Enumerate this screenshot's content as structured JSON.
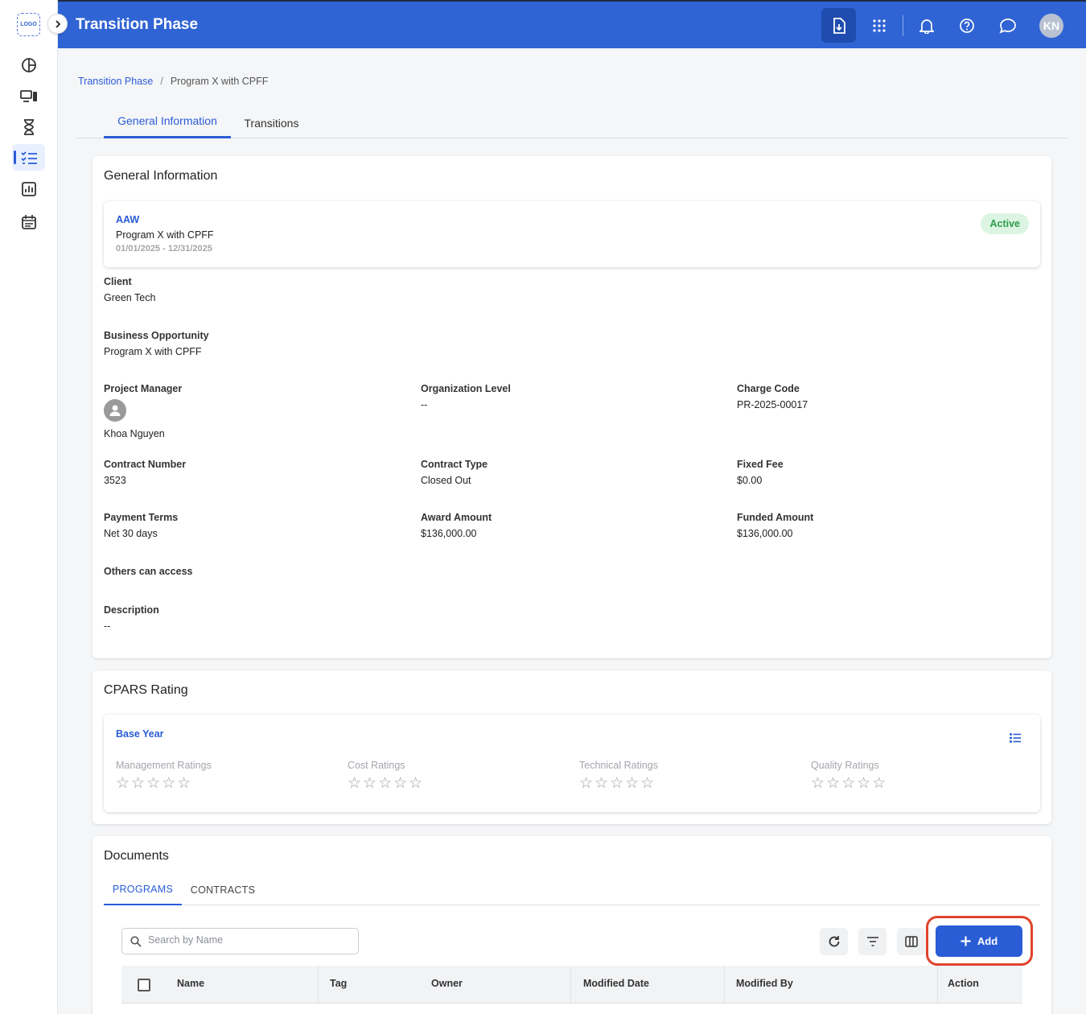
{
  "app": {
    "logo_text": "LOGO",
    "title": "Transition Phase",
    "user_initials": "KN"
  },
  "breadcrumb": {
    "root": "Transition Phase",
    "separator": "/",
    "current": "Program X with CPFF"
  },
  "tabs": [
    {
      "label": "General Information",
      "active": true
    },
    {
      "label": "Transitions",
      "active": false
    }
  ],
  "general_info": {
    "title": "General Information",
    "summary": {
      "code": "AAW",
      "name": "Program X with CPFF",
      "dates": "01/01/2025 - 12/31/2025",
      "status": "Active"
    },
    "client": {
      "label": "Client",
      "value": "Green Tech"
    },
    "business_opportunity": {
      "label": "Business Opportunity",
      "value": "Program X with CPFF"
    },
    "project_manager": {
      "label": "Project Manager",
      "value": "Khoa Nguyen"
    },
    "organization_level": {
      "label": "Organization Level",
      "value": "--"
    },
    "charge_code": {
      "label": "Charge Code",
      "value": "PR-2025-00017"
    },
    "contract_number": {
      "label": "Contract Number",
      "value": "3523"
    },
    "contract_type": {
      "label": "Contract Type",
      "value": "Closed Out"
    },
    "fixed_fee": {
      "label": "Fixed Fee",
      "value": "$0.00"
    },
    "payment_terms": {
      "label": "Payment Terms",
      "value": "Net 30 days"
    },
    "award_amount": {
      "label": "Award Amount",
      "value": "$136,000.00"
    },
    "funded_amount": {
      "label": "Funded Amount",
      "value": "$136,000.00"
    },
    "others_access": {
      "label": "Others can access",
      "value": ""
    },
    "description": {
      "label": "Description",
      "value": "--"
    }
  },
  "cpars": {
    "title": "CPARS Rating",
    "period": "Base Year",
    "ratings": [
      {
        "label": "Management Ratings",
        "stars": 0,
        "max": 5
      },
      {
        "label": "Cost Ratings",
        "stars": 0,
        "max": 5
      },
      {
        "label": "Technical Ratings",
        "stars": 0,
        "max": 5
      },
      {
        "label": "Quality Ratings",
        "stars": 0,
        "max": 5
      }
    ]
  },
  "documents": {
    "title": "Documents",
    "tabs": [
      {
        "label": "PROGRAMS",
        "active": true
      },
      {
        "label": "CONTRACTS",
        "active": false
      }
    ],
    "search_placeholder": "Search by Name",
    "add_label": "Add",
    "columns": [
      "Name",
      "Tag",
      "Owner",
      "Modified Date",
      "Modified By",
      "Action"
    ]
  },
  "colors": {
    "primary": "#3064d4",
    "accent_blue": "#2a5cd6",
    "status_active_bg": "#dcf5e2",
    "status_active_text": "#2e9b4c",
    "highlight_ring": "#e0432c"
  }
}
